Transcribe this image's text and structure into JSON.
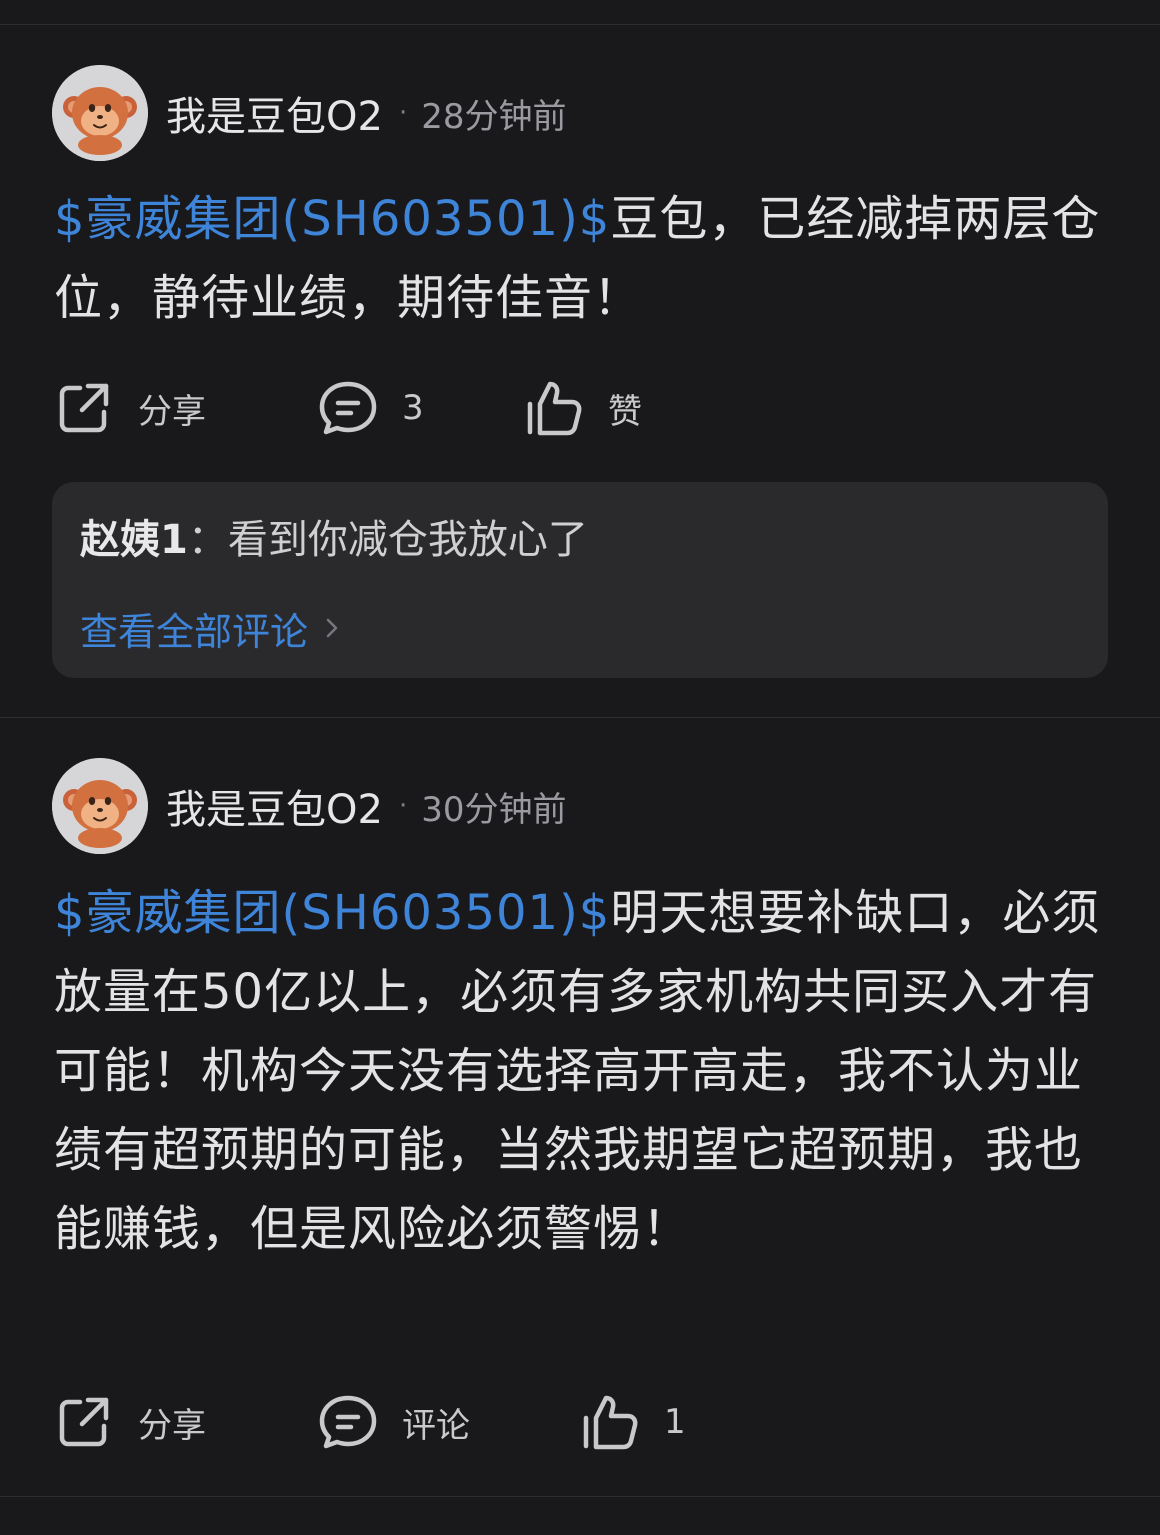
{
  "posts": [
    {
      "author": "我是豆包O2",
      "separator": "·",
      "time": "28分钟前",
      "stock_tag": "$豪威集团(SH603501)$",
      "text": "豆包，已经减掉两层仓位，静待业绩，期待佳音！",
      "actions": {
        "share_label": "分享",
        "comment_label": "3",
        "like_label": "赞"
      },
      "top_comment": {
        "user": "赵姨1",
        "text": "：看到你减仓我放心了"
      },
      "view_all_label": "查看全部评论"
    },
    {
      "author": "我是豆包O2",
      "separator": "·",
      "time": "30分钟前",
      "stock_tag": "$豪威集团(SH603501)$",
      "text": "明天想要补缺口，必须放量在50亿以上，必须有多家机构共同买入才有可能！机构今天没有选择高开高走，我不认为业绩有超预期的可能，当然我期望它超预期，我也能赚钱，但是风险必须警惕！",
      "actions": {
        "share_label": "分享",
        "comment_label": "评论",
        "like_label": "1"
      }
    }
  ],
  "icons": {
    "share": "share-icon",
    "comment": "comment-icon",
    "like": "thumbs-up-icon",
    "chevron": "chevron-right-icon",
    "avatar": "monkey-avatar-icon"
  },
  "colors": {
    "background": "#19191b",
    "link": "#3e84d8",
    "comment_box": "#2a2a2d"
  }
}
